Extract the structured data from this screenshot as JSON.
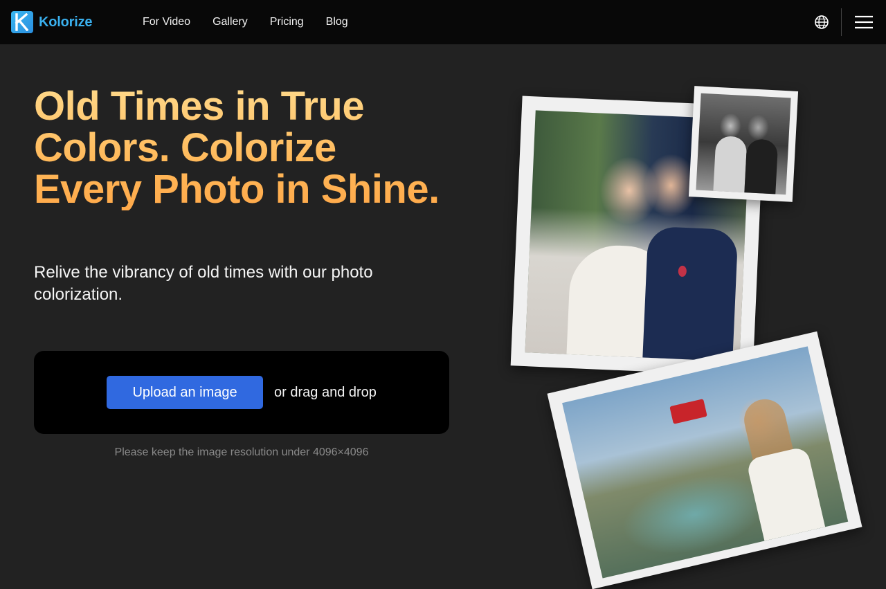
{
  "brand": {
    "name": "Kolorize",
    "logo_letter": "K",
    "color": "#3ab0ee"
  },
  "nav": {
    "items": [
      {
        "label": "For Video"
      },
      {
        "label": "Gallery"
      },
      {
        "label": "Pricing"
      },
      {
        "label": "Blog"
      }
    ]
  },
  "header_icons": {
    "language": "globe-icon",
    "menu": "hamburger-menu-icon"
  },
  "hero": {
    "title": "Old Times in True Colors. Colorize Every Photo in Shine.",
    "subtitle": "Relive the vibrancy of old times with our photo colorization.",
    "title_gradient": [
      "#ffd98a",
      "#ffa94a"
    ]
  },
  "upload": {
    "button_label": "Upload an image",
    "drag_text": "or drag and drop",
    "note": "Please keep the image resolution under 4096×4096",
    "button_color": "#3069e0"
  }
}
